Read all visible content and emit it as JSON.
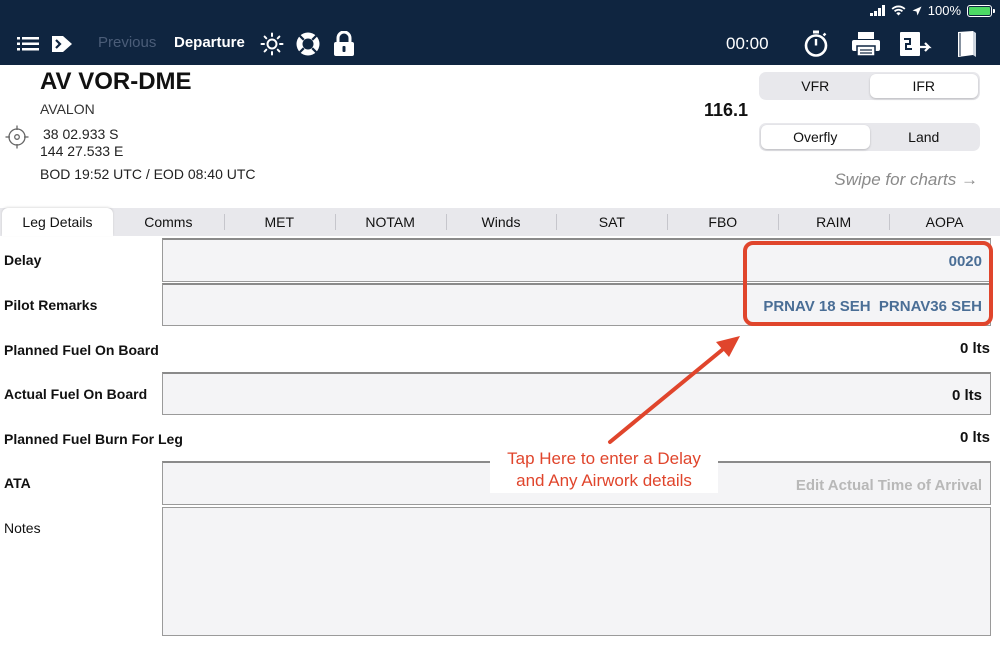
{
  "status": {
    "battery": "100%"
  },
  "nav": {
    "previous": "Previous",
    "departure": "Departure",
    "timer": "00:00",
    "icons": [
      "list-icon",
      "route-icon",
      "brightness-icon",
      "lifebuoy-icon",
      "lock-icon",
      "stopwatch-icon",
      "printer-icon",
      "clipboard-icon",
      "book-icon"
    ]
  },
  "waypoint": {
    "name": "AV VOR-DME",
    "location": "AVALON",
    "latitude": "38 02.933 S",
    "longitude": "144 27.533 E",
    "daylight": "BOD 19:52 UTC / EOD 08:40 UTC",
    "frequency": "116.1"
  },
  "flight_rules": {
    "options": [
      "VFR",
      "IFR"
    ],
    "selected": "IFR"
  },
  "approach": {
    "options": [
      "Overfly",
      "Land"
    ],
    "selected": "Overfly"
  },
  "swipe_hint": "Swipe for charts →",
  "tabs": [
    "Leg Details",
    "Comms",
    "MET",
    "NOTAM",
    "Winds",
    "SAT",
    "FBO",
    "RAIM",
    "AOPA"
  ],
  "active_tab": "Leg Details",
  "form": {
    "delay": {
      "label": "Delay",
      "value": "0020"
    },
    "pilot_remarks": {
      "label": "Pilot Remarks",
      "value": "PRNAV 18 SEH  PRNAV36 SEH"
    },
    "planned_fuel": {
      "label": "Planned Fuel On Board",
      "value": "0 lts"
    },
    "actual_fuel": {
      "label": "Actual Fuel On Board",
      "value": "0 lts"
    },
    "planned_burn": {
      "label": "Planned Fuel Burn For Leg",
      "value": "0 lts"
    },
    "ata": {
      "label": "ATA",
      "placeholder": "Edit Actual Time of Arrival"
    },
    "notes": {
      "label": "Notes",
      "value": ""
    }
  },
  "annotation": {
    "line1": "Tap Here to enter a Delay",
    "line2": "and Any Airwork details",
    "color": "#e0452c"
  },
  "colors": {
    "navbar": "#0f2540",
    "value_blue": "#4a6e96"
  }
}
